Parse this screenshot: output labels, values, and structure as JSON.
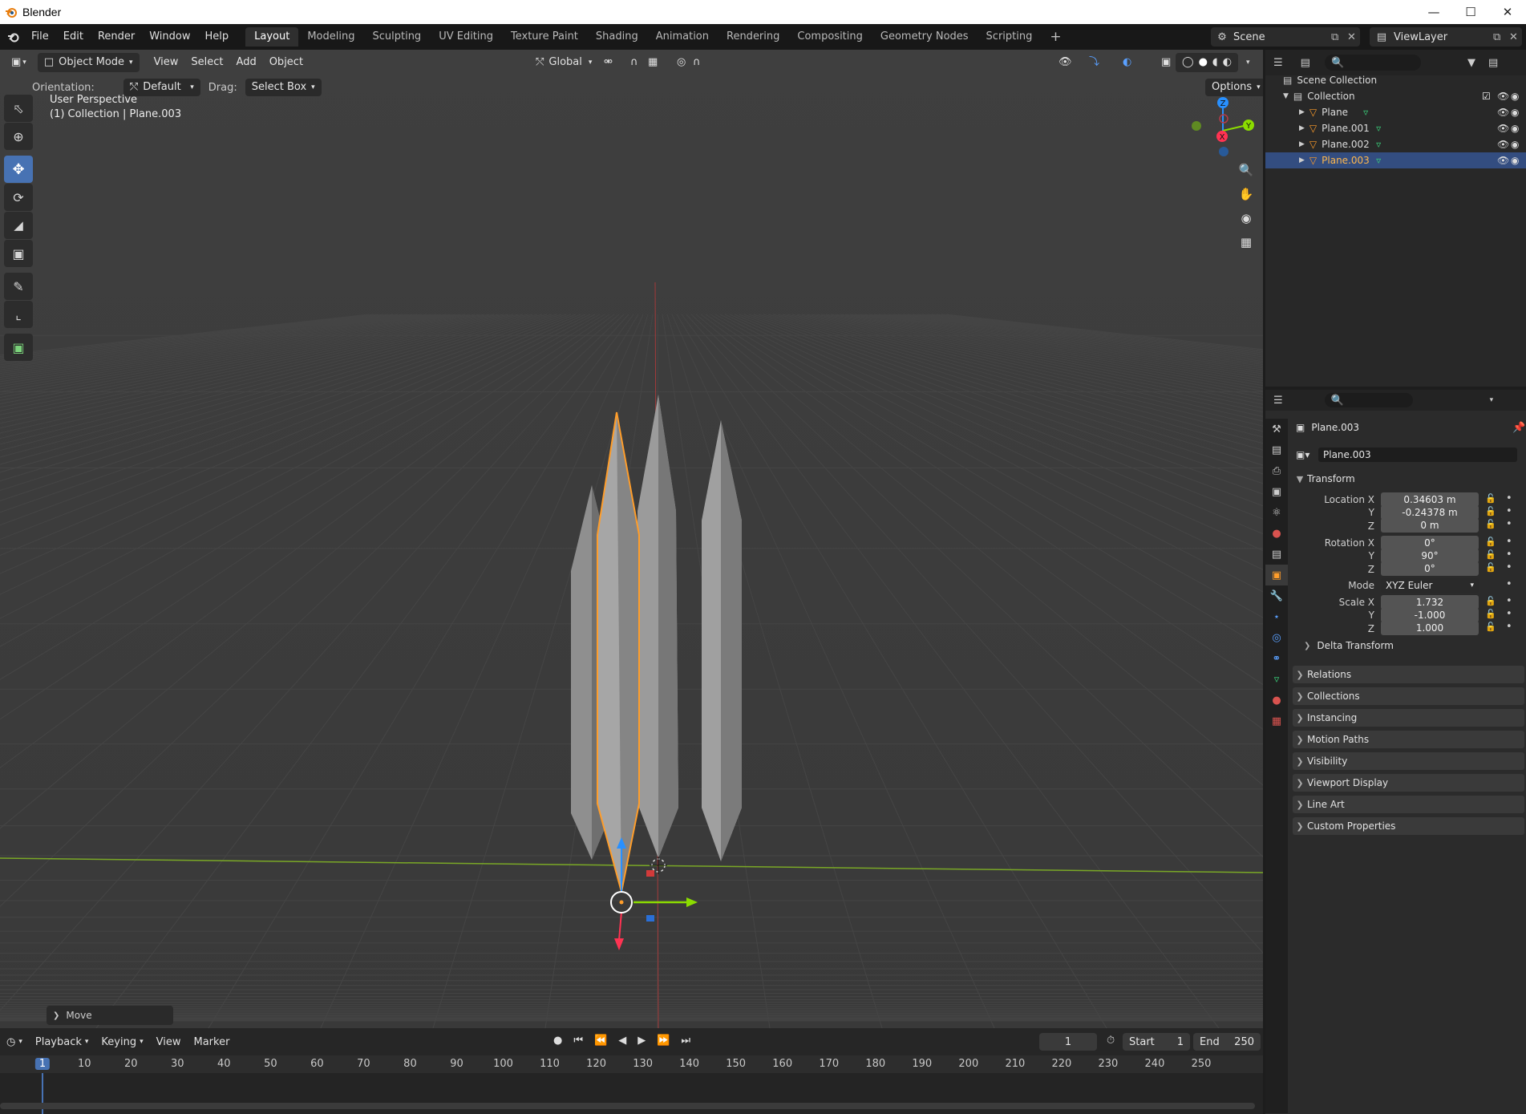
{
  "window": {
    "title": "Blender"
  },
  "menus": [
    "File",
    "Edit",
    "Render",
    "Window",
    "Help"
  ],
  "workspaces": {
    "tabs": [
      "Layout",
      "Modeling",
      "Sculpting",
      "UV Editing",
      "Texture Paint",
      "Shading",
      "Animation",
      "Rendering",
      "Compositing",
      "Geometry Nodes",
      "Scripting"
    ],
    "active": "Layout"
  },
  "scene": {
    "name": "Scene"
  },
  "view_layer": {
    "name": "ViewLayer"
  },
  "viewport": {
    "mode": "Object Mode",
    "menus": [
      "View",
      "Select",
      "Add",
      "Object"
    ],
    "transform_orientation": "Global",
    "orientation_label": "Orientation:",
    "orientation_value": "Default",
    "drag_label": "Drag:",
    "drag_value": "Select Box",
    "options_label": "Options",
    "info_line1": "User Perspective",
    "info_line2": "(1) Collection | Plane.003",
    "last_operator": "Move",
    "gizmo_axes": {
      "z": "Z",
      "y": "Y",
      "x": "X"
    }
  },
  "timeline": {
    "menus": [
      "Playback",
      "Keying",
      "View",
      "Marker"
    ],
    "current_frame": "1",
    "start_label": "Start",
    "start": "1",
    "end_label": "End",
    "end": "250",
    "ruler": [
      "1",
      "10",
      "20",
      "30",
      "40",
      "50",
      "60",
      "70",
      "80",
      "90",
      "100",
      "110",
      "120",
      "130",
      "140",
      "150",
      "160",
      "170",
      "180",
      "190",
      "200",
      "210",
      "220",
      "230",
      "240",
      "250"
    ]
  },
  "outliner": {
    "root": "Scene Collection",
    "collection": "Collection",
    "items": [
      "Plane",
      "Plane.001",
      "Plane.002",
      "Plane.003"
    ],
    "selected": "Plane.003"
  },
  "properties": {
    "object_name": "Plane.003",
    "datablock_name": "Plane.003",
    "transform": {
      "title": "Transform",
      "location_label": "Location X",
      "location": [
        "0.34603 m",
        "-0.24378 m",
        "0 m"
      ],
      "rotation_label": "Rotation X",
      "rotation": [
        "0°",
        "90°",
        "0°"
      ],
      "mode_label": "Mode",
      "mode": "XYZ Euler",
      "scale_label": "Scale X",
      "scale": [
        "1.732",
        "-1.000",
        "1.000"
      ],
      "axis_y": "Y",
      "axis_z": "Z",
      "delta": "Delta Transform"
    },
    "sections": [
      "Relations",
      "Collections",
      "Instancing",
      "Motion Paths",
      "Visibility",
      "Viewport Display",
      "Line Art",
      "Custom Properties"
    ]
  },
  "colors": {
    "accent": "#4772b3",
    "selection_outline": "#ff9d2a",
    "axis_x": "#ff3352",
    "axis_y": "#8bdc00",
    "axis_z": "#2890ff"
  }
}
